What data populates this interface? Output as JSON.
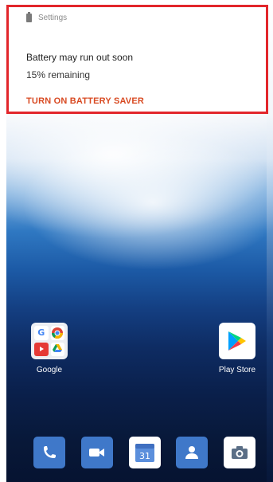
{
  "notification": {
    "app_name": "Settings",
    "title": "Battery may run out soon",
    "text": "15% remaining",
    "action_label": "TURN ON BATTERY SAVER",
    "border_color": "#e2262b",
    "action_color": "#d84a22",
    "icon": "battery-icon"
  },
  "home": {
    "apps": [
      {
        "label": "Google",
        "icon": "google-folder-icon"
      },
      {
        "label": "Play Store",
        "icon": "play-store-icon"
      }
    ]
  },
  "dock": {
    "items": [
      {
        "name": "phone",
        "icon": "phone-icon",
        "color": "#3f78c9"
      },
      {
        "name": "duo",
        "icon": "video-camera-icon",
        "color": "#3f78c9"
      },
      {
        "name": "calendar",
        "icon": "calendar-icon",
        "color": "#ffffff",
        "text": "31"
      },
      {
        "name": "contacts",
        "icon": "contacts-icon",
        "color": "#3f78c9"
      },
      {
        "name": "camera",
        "icon": "camera-icon",
        "color": "#ffffff"
      }
    ]
  }
}
